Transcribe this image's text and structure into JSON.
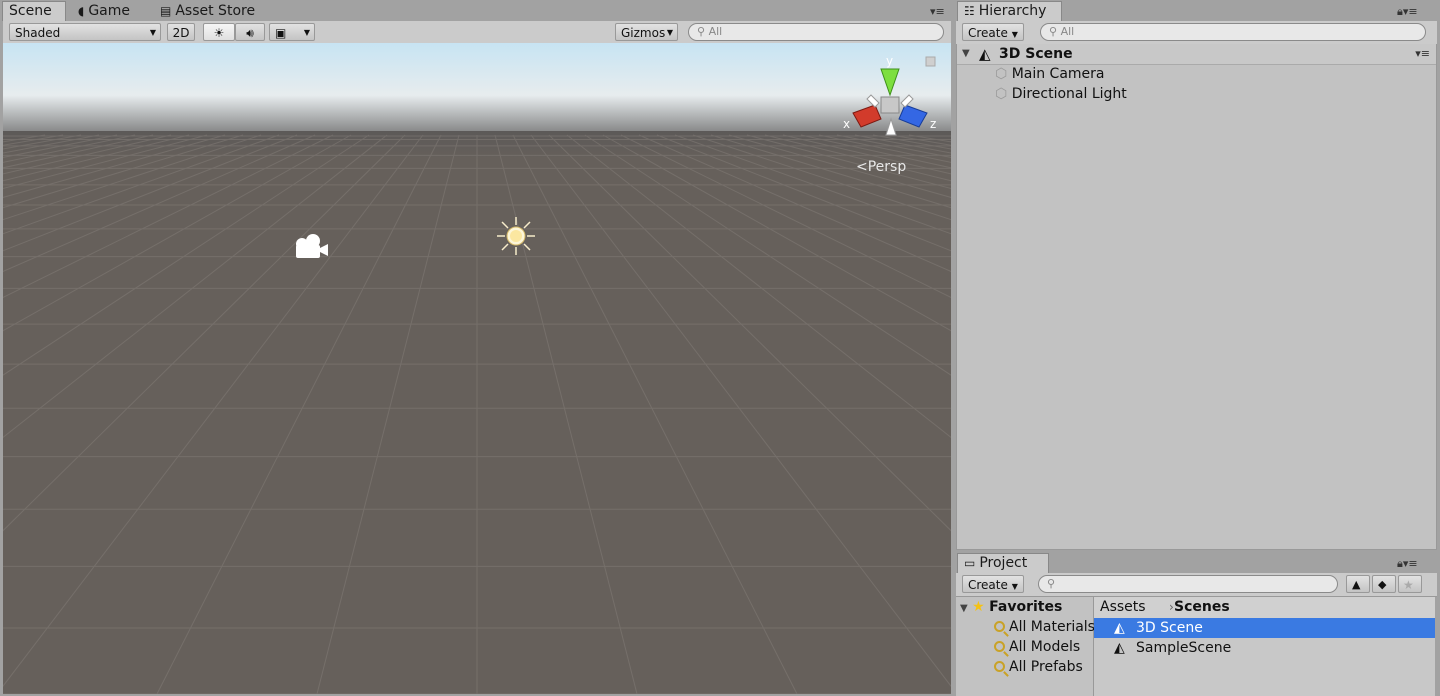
{
  "scene": {
    "tabs": [
      {
        "label": "Scene",
        "active": true
      },
      {
        "label": "Game",
        "icon": "pacman-icon"
      },
      {
        "label": "Asset Store",
        "icon": "shopping-bag-icon"
      }
    ],
    "toolbar": {
      "shading_mode": "Shaded",
      "btn_2d": "2D",
      "gizmos_label": "Gizmos",
      "search_placeholder": "All"
    },
    "gizmo": {
      "x": "x",
      "y": "y",
      "z": "z",
      "projection": "Persp"
    }
  },
  "hierarchy": {
    "tab_label": "Hierarchy",
    "create_label": "Create",
    "search_placeholder": "All",
    "scene_name": "3D Scene",
    "objects": [
      "Main Camera",
      "Directional Light"
    ]
  },
  "project": {
    "tab_label": "Project",
    "create_label": "Create",
    "favorites": {
      "label": "Favorites",
      "items": [
        "All Materials",
        "All Models",
        "All Prefabs"
      ]
    },
    "breadcrumb": [
      "Assets",
      "Scenes"
    ],
    "assets": [
      {
        "name": "3D Scene",
        "selected": true
      },
      {
        "name": "SampleScene",
        "selected": false
      }
    ]
  },
  "colors": {
    "selection": "#3a7ae2",
    "viewport_ground": "#66605b",
    "sky_top": "#c8e6f5"
  }
}
